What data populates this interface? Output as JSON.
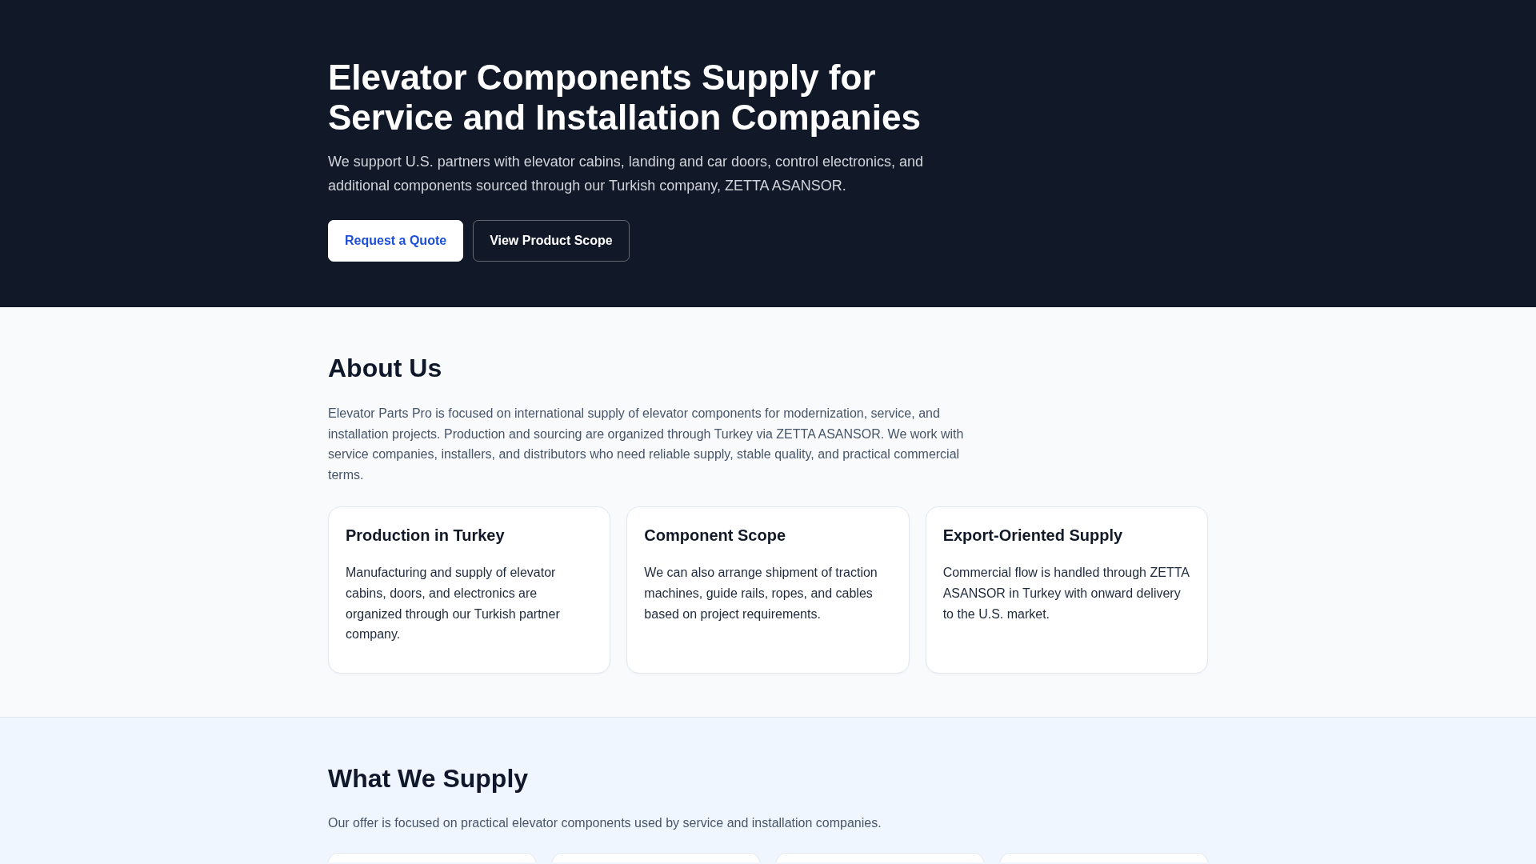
{
  "hero": {
    "title": "Elevator Components Supply for Service and Installation Companies",
    "text": "We support U.S. partners with elevator cabins, landing and car doors, control electronics, and additional components sourced through our Turkish company, ZETTA ASANSOR.",
    "buttons": [
      {
        "label": "Request a Quote",
        "kind": "primary"
      },
      {
        "label": "View Product Scope",
        "kind": "outline"
      }
    ]
  },
  "about": {
    "heading": "About Us",
    "text": "Elevator Parts Pro is focused on international supply of elevator components for modernization, service, and installation projects. Production and sourcing are organized through Turkey via ZETTA ASANSOR. We work with service companies, installers, and distributors who need reliable supply, stable quality, and practical commercial terms.",
    "cards": [
      {
        "title": "Production in Turkey",
        "text": "Manufacturing and supply of elevator cabins, doors, and electronics are organized through our Turkish partner company."
      },
      {
        "title": "Component Scope",
        "text": "We can also arrange shipment of traction machines, guide rails, ropes, and cables based on project requirements."
      },
      {
        "title": "Export-Oriented Supply",
        "text": "Commercial flow is handled through ZETTA ASANSOR in Turkey with onward delivery to the U.S. market."
      }
    ]
  },
  "supply": {
    "heading": "What We Supply",
    "text": "Our offer is focused on practical elevator components used by service and installation companies."
  }
}
